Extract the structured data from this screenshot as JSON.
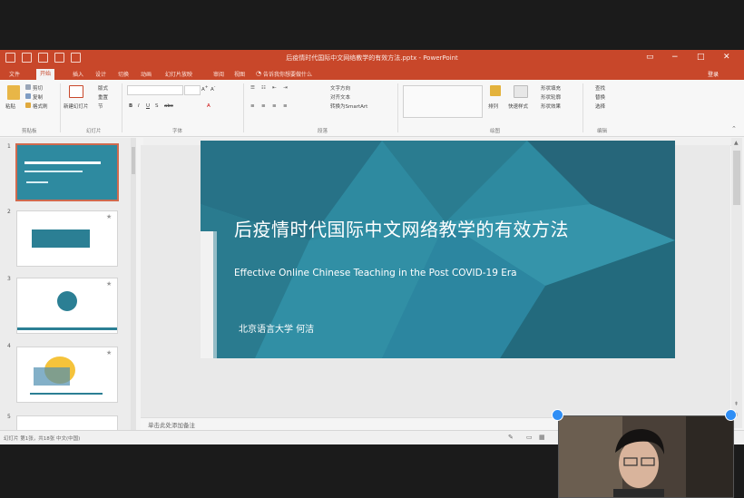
{
  "window": {
    "title": "后疫情时代国际中文网络教学的有效方法.pptx - PowerPoint",
    "sign_in": "登录",
    "min_glyph": "−",
    "max_glyph": "□",
    "close_glyph": "✕"
  },
  "ribbon_tabs": [
    {
      "label": "文件",
      "active": false
    },
    {
      "label": "开始",
      "active": true
    },
    {
      "label": "插入",
      "active": false
    },
    {
      "label": "设计",
      "active": false
    },
    {
      "label": "切换",
      "active": false
    },
    {
      "label": "动画",
      "active": false
    },
    {
      "label": "幻灯片放映",
      "active": false
    },
    {
      "label": "审阅",
      "active": false
    },
    {
      "label": "视图",
      "active": false
    },
    {
      "label": "帮助",
      "active": false
    }
  ],
  "search_tell": "告诉我你想要做什么",
  "ribbon": {
    "paste": "粘贴",
    "cut": "剪切",
    "copy": "复制",
    "format_painter": "格式刷",
    "new_slide": "新建幻灯片",
    "layout": "版式",
    "reset": "重置",
    "section": "节",
    "font_name": "",
    "font_size": "",
    "text_direction": "文字方向",
    "align_text": "对齐文本",
    "smartart": "转换为SmartArt",
    "arrange": "排列",
    "quick_styles": "快速样式",
    "shape_fill": "形状填充",
    "shape_outline": "形状轮廓",
    "shape_effects": "形状效果",
    "find": "查找",
    "replace": "替换",
    "select": "选择",
    "groups": [
      "剪贴板",
      "幻灯片",
      "字体",
      "段落",
      "绘图",
      "编辑"
    ]
  },
  "thumbnails": [
    {
      "num": "1",
      "selected": true
    },
    {
      "num": "2",
      "selected": false
    },
    {
      "num": "3",
      "selected": false
    },
    {
      "num": "4",
      "selected": false
    },
    {
      "num": "5",
      "selected": false
    }
  ],
  "slide": {
    "title": "后疫情时代国际中文网络教学的有效方法",
    "subtitle": "Effective Online Chinese Teaching in the Post COVID-19 Era",
    "author": "北京语言大学 何洁",
    "bg_color": "#2e8aa0"
  },
  "notes_placeholder": "单击此处添加备注",
  "status": {
    "left": "幻灯片 第1张，共18张   中文(中国)"
  },
  "colors": {
    "accent": "#c8472a",
    "slide_teal": "#2e8aa0"
  }
}
